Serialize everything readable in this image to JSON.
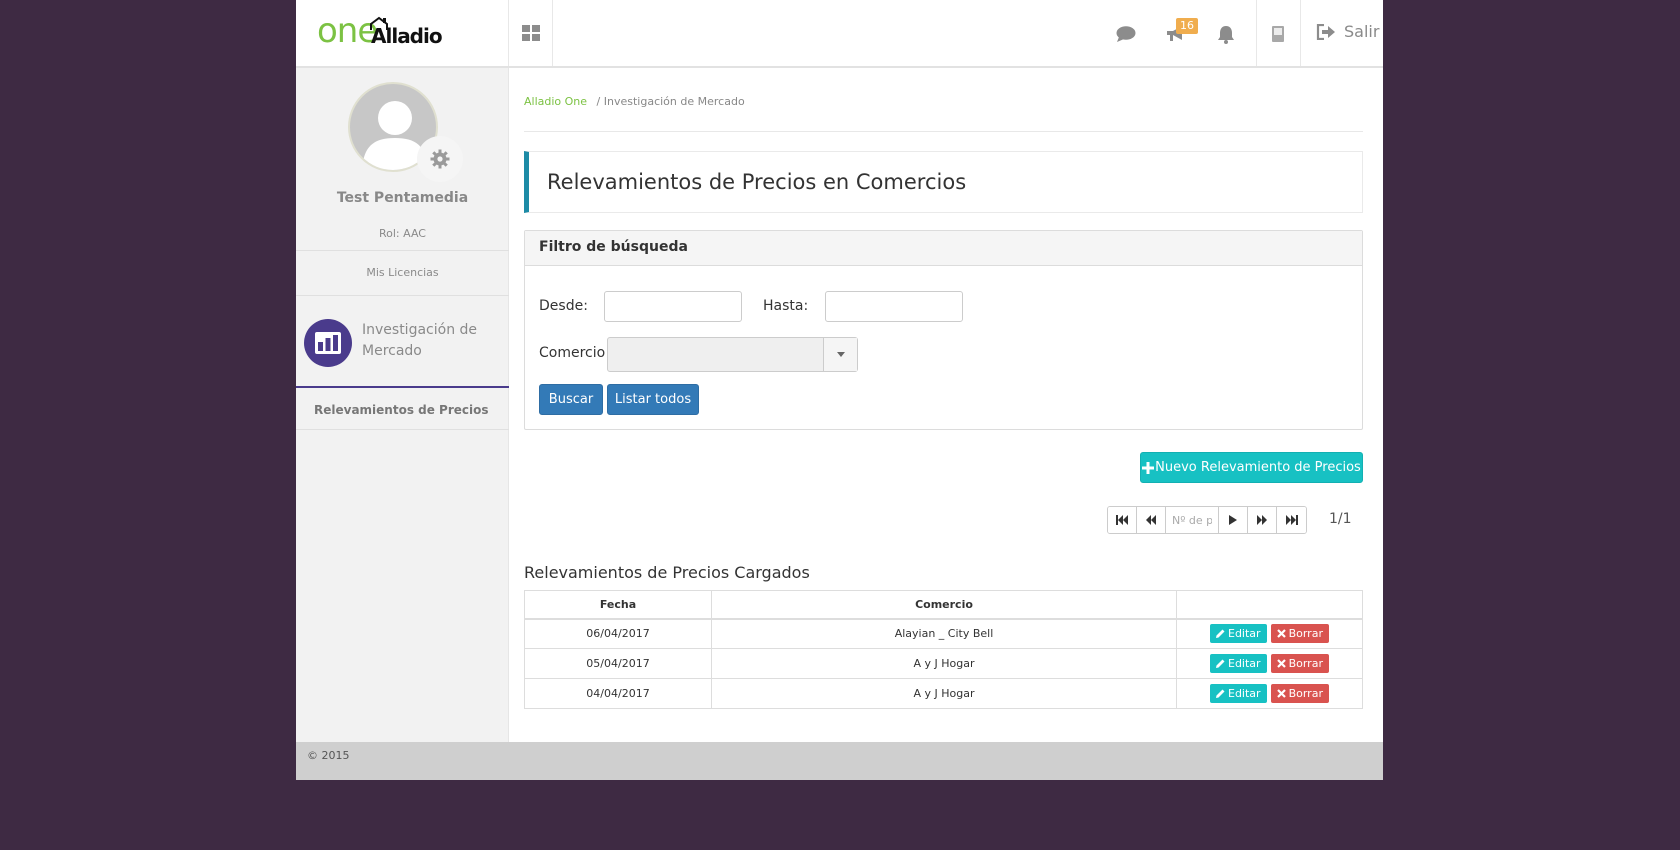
{
  "header": {
    "logo_one": "one",
    "logo_brand": "Alladio",
    "notif_badge": "16",
    "logout_label": "Salir"
  },
  "sidebar": {
    "user_name": "Test Pentamedia",
    "role": "Rol: AAC",
    "licencias": "Mis Licencias",
    "module_label": "Investigación de Mercado",
    "submenu_item": "Relevamientos de Precios"
  },
  "breadcrumb": {
    "home": "Alladio One",
    "separator": "/",
    "current": "Investigación de Mercado"
  },
  "page_title": "Relevamientos de Precios en Comercios",
  "filter": {
    "title": "Filtro de búsqueda",
    "desde_label": "Desde:",
    "desde_value": "",
    "hasta_label": "Hasta:",
    "hasta_value": "",
    "comercio_label": "Comercio",
    "comercio_value": "",
    "search_button": "Buscar",
    "list_all_button": "Listar todos"
  },
  "new_button": "Nuevo Relevamiento de Precios",
  "pager": {
    "input_placeholder": "Nº de página",
    "page_count": "1/1"
  },
  "results": {
    "title": "Relevamientos de Precios Cargados",
    "columns": [
      "Fecha",
      "Comercio",
      ""
    ],
    "rows": [
      {
        "fecha": "06/04/2017",
        "comercio": "Alayian _ City Bell"
      },
      {
        "fecha": "05/04/2017",
        "comercio": "A y J Hogar"
      },
      {
        "fecha": "04/04/2017",
        "comercio": "A y J Hogar"
      }
    ],
    "edit_label": "Editar",
    "delete_label": "Borrar"
  },
  "footer": "© 2015",
  "colors": {
    "background": "#3e2a43",
    "accent_teal": "#17c1c3",
    "primary_blue": "#337ab7",
    "danger": "#d9534f",
    "module_purple": "#4a3b8c",
    "brand_green": "#7cc243"
  }
}
